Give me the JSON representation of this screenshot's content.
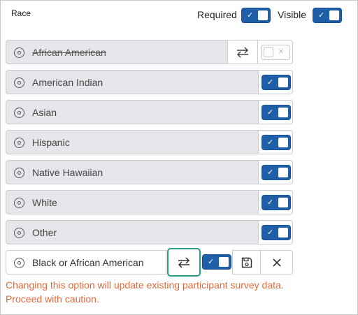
{
  "field": {
    "title": "Race",
    "required_label": "Required",
    "visible_label": "Visible",
    "required_on": true,
    "visible_on": true
  },
  "options": [
    {
      "label": "African American",
      "struck": true,
      "enabled": false
    },
    {
      "label": "American Indian",
      "struck": false,
      "enabled": true
    },
    {
      "label": "Asian",
      "struck": false,
      "enabled": true
    },
    {
      "label": "Hispanic",
      "struck": false,
      "enabled": true
    },
    {
      "label": "Native Hawaiian",
      "struck": false,
      "enabled": true
    },
    {
      "label": "White",
      "struck": false,
      "enabled": true
    },
    {
      "label": "Other",
      "struck": false,
      "enabled": true
    }
  ],
  "edit_row": {
    "value": "Black or African American",
    "enabled": true
  },
  "warning": {
    "line1": "Changing this option will update existing participant survey data.",
    "line2": "Proceed with caution."
  },
  "colors": {
    "toggle_on": "#1f5fa8",
    "focus_ring": "#2a9d86",
    "warning_text": "#e2693c"
  }
}
